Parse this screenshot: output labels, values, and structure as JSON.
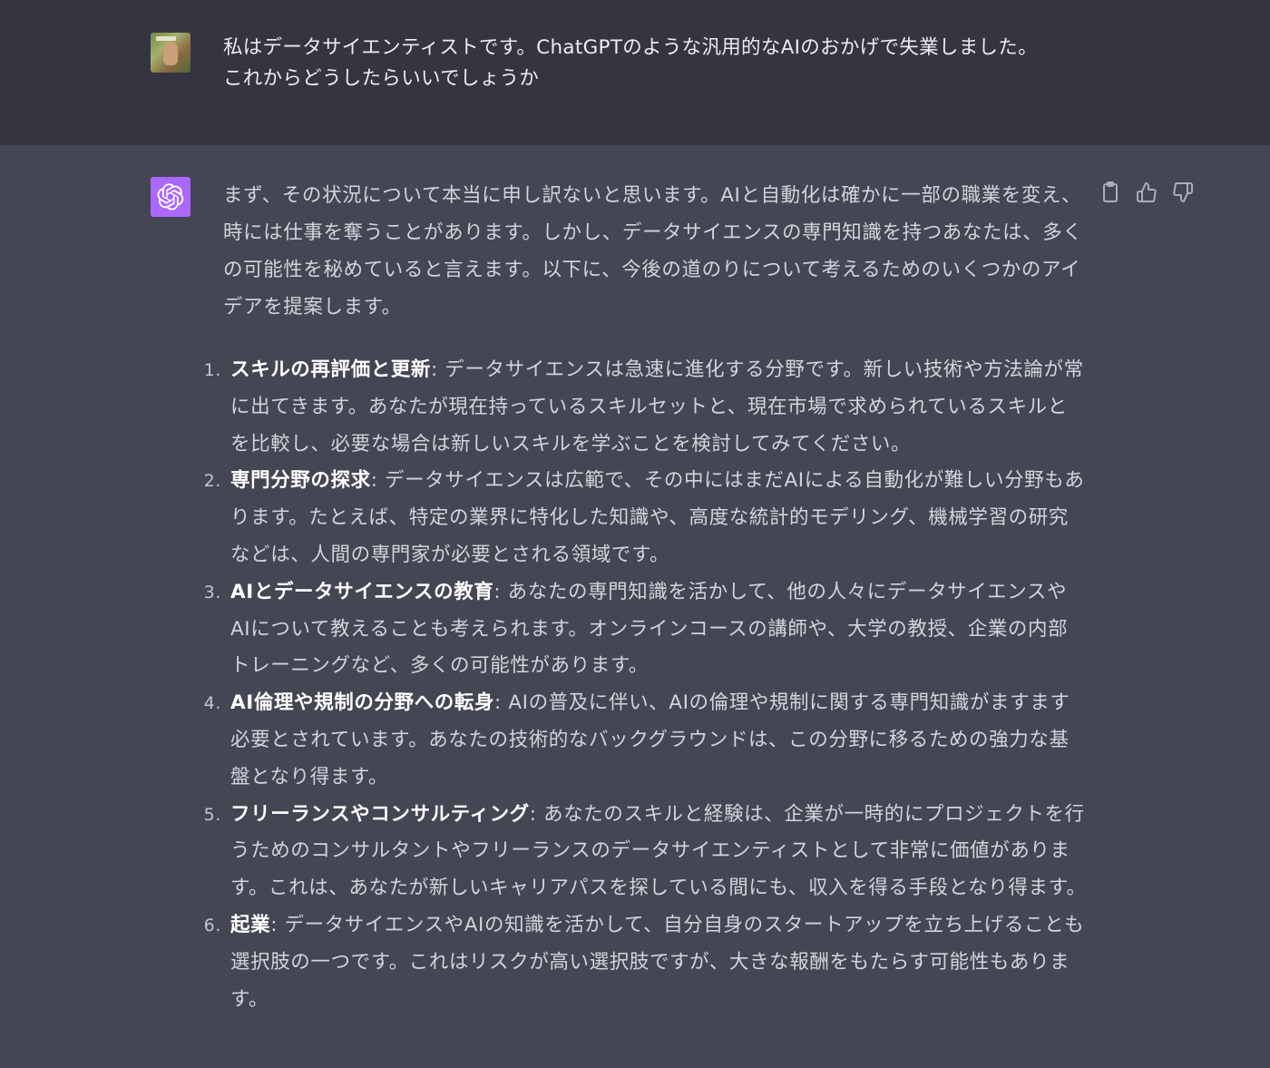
{
  "user_message": {
    "avatar": "user-avatar-photo",
    "lines": [
      "私はデータサイエンティストです。ChatGPTのような汎用的なAIのおかげで失業しました。",
      "これからどうしたらいいでしょうか"
    ]
  },
  "assistant_message": {
    "avatar": "openai-logo-icon",
    "avatar_color": "#ab68ff",
    "intro": "まず、その状況について本当に申し訳ないと思います。AIと自動化は確かに一部の職業を変え、時には仕事を奪うことがあります。しかし、データサイエンスの専門知識を持つあなたは、多くの可能性を秘めていると言えます。以下に、今後の道のりについて考えるためのいくつかのアイデアを提案します。",
    "items": [
      {
        "number": "1.",
        "title": "スキルの再評価と更新",
        "text": ": データサイエンスは急速に進化する分野です。新しい技術や方法論が常に出てきます。あなたが現在持っているスキルセットと、現在市場で求められているスキルとを比較し、必要な場合は新しいスキルを学ぶことを検討してみてください。"
      },
      {
        "number": "2.",
        "title": "専門分野の探求",
        "text": ": データサイエンスは広範で、その中にはまだAIによる自動化が難しい分野もあります。たとえば、特定の業界に特化した知識や、高度な統計的モデリング、機械学習の研究などは、人間の専門家が必要とされる領域です。"
      },
      {
        "number": "3.",
        "title": "AIとデータサイエンスの教育",
        "text": ": あなたの専門知識を活かして、他の人々にデータサイエンスやAIについて教えることも考えられます。オンラインコースの講師や、大学の教授、企業の内部トレーニングなど、多くの可能性があります。"
      },
      {
        "number": "4.",
        "title": "AI倫理や規制の分野への転身",
        "text": ": AIの普及に伴い、AIの倫理や規制に関する専門知識がますます必要とされています。あなたの技術的なバックグラウンドは、この分野に移るための強力な基盤となり得ます。"
      },
      {
        "number": "5.",
        "title": "フリーランスやコンサルティング",
        "text": ": あなたのスキルと経験は、企業が一時的にプロジェクトを行うためのコンサルタントやフリーランスのデータサイエンティストとして非常に価値があります。これは、あなたが新しいキャリアパスを探している間にも、収入を得る手段となり得ます。"
      },
      {
        "number": "6.",
        "title": "起業",
        "text": ": データサイエンスやAIの知識を活かして、自分自身のスタートアップを立ち上げることも選択肢の一つです。これはリスクが高い選択肢ですが、大きな報酬をもたらす可能性もあります。"
      }
    ],
    "actions": [
      {
        "icon": "clipboard-icon"
      },
      {
        "icon": "thumbs-up-icon"
      },
      {
        "icon": "thumbs-down-icon"
      }
    ]
  },
  "colors": {
    "user_bg": "#343541",
    "assistant_bg": "#444654",
    "text": "#d1d5db",
    "bold_text": "#ffffff"
  }
}
